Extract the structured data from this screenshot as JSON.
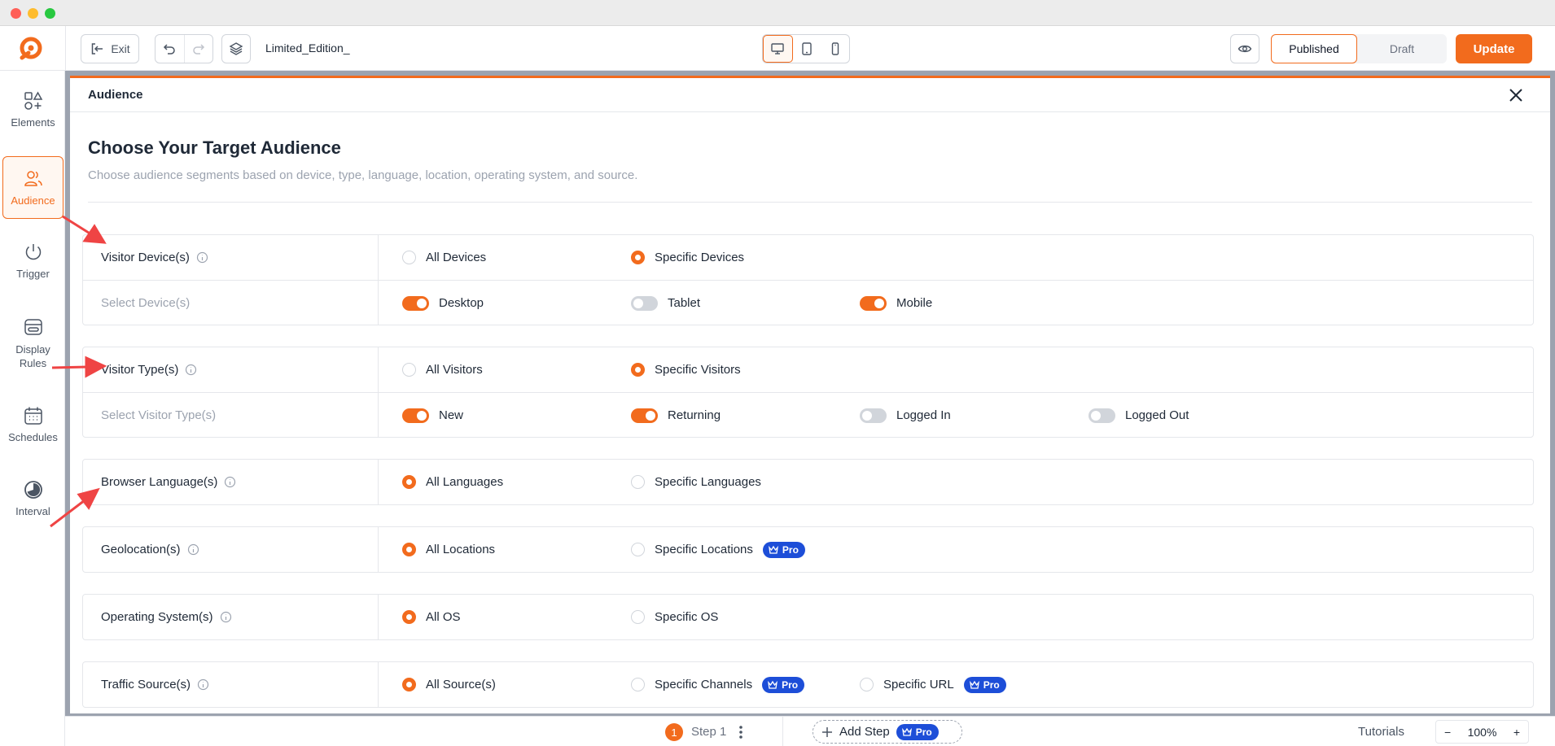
{
  "toolbar": {
    "exit_label": "Exit",
    "page_name": "Limited_Edition_",
    "published_label": "Published",
    "draft_label": "Draft",
    "update_label": "Update"
  },
  "sidebar": {
    "items": [
      {
        "label": "Elements",
        "icon": "elements-icon"
      },
      {
        "label": "Audience",
        "icon": "audience-icon",
        "active": true
      },
      {
        "label": "Trigger",
        "icon": "power-icon"
      },
      {
        "label": "Display Rules",
        "icon": "display-rules-icon"
      },
      {
        "label": "Schedules",
        "icon": "calendar-icon"
      },
      {
        "label": "Interval",
        "icon": "interval-icon"
      }
    ]
  },
  "modal": {
    "title": "Audience",
    "heading": "Choose Your Target Audience",
    "subheading": "Choose audience segments based on device, type, language, location, operating system, and source.",
    "visitor_device": {
      "label": "Visitor Device(s)",
      "option_all": "All Devices",
      "option_specific": "Specific Devices",
      "selected": "specific",
      "select_label": "Select Device(s)",
      "toggles": [
        {
          "label": "Desktop",
          "on": true
        },
        {
          "label": "Tablet",
          "on": false
        },
        {
          "label": "Mobile",
          "on": true
        }
      ]
    },
    "visitor_type": {
      "label": "Visitor Type(s)",
      "option_all": "All Visitors",
      "option_specific": "Specific Visitors",
      "selected": "specific",
      "select_label": "Select Visitor Type(s)",
      "toggles": [
        {
          "label": "New",
          "on": true
        },
        {
          "label": "Returning",
          "on": true
        },
        {
          "label": "Logged In",
          "on": false
        },
        {
          "label": "Logged Out",
          "on": false
        }
      ]
    },
    "browser_language": {
      "label": "Browser Language(s)",
      "option_all": "All Languages",
      "option_specific": "Specific Languages",
      "selected": "all"
    },
    "geolocation": {
      "label": "Geolocation(s)",
      "option_all": "All Locations",
      "option_specific": "Specific Locations",
      "selected": "all",
      "pro_badge": "Pro"
    },
    "operating_system": {
      "label": "Operating System(s)",
      "option_all": "All OS",
      "option_specific": "Specific OS",
      "selected": "all"
    },
    "traffic_source": {
      "label": "Traffic Source(s)",
      "option_all": "All Source(s)",
      "option_channels": "Specific Channels",
      "option_url": "Specific URL",
      "selected": "all",
      "pro_badge": "Pro"
    }
  },
  "bottombar": {
    "step_number": "1",
    "step_label": "Step 1",
    "add_step_label": "Add Step",
    "pro_badge": "Pro",
    "tutorials_label": "Tutorials",
    "zoom_level": "100%",
    "zoom_minus": "−",
    "zoom_plus": "+"
  },
  "colors": {
    "accent": "#f26b1d",
    "pro_badge": "#1d4ed8",
    "annotation_arrow": "#ef4444"
  }
}
